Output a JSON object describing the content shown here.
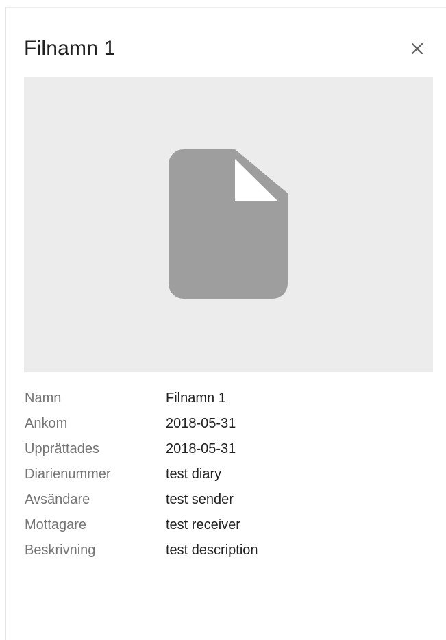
{
  "title": "Filnamn 1",
  "close_icon": "close-icon",
  "preview": {
    "icon": "file-icon",
    "background_color": "#ececec",
    "icon_color": "#9e9e9e"
  },
  "details": [
    {
      "label": "Namn",
      "value": "Filnamn 1"
    },
    {
      "label": "Ankom",
      "value": "2018-05-31"
    },
    {
      "label": "Upprättades",
      "value": "2018-05-31"
    },
    {
      "label": "Diarienummer",
      "value": "test diary"
    },
    {
      "label": "Avsändare",
      "value": "test sender"
    },
    {
      "label": "Mottagare",
      "value": "test receiver"
    },
    {
      "label": "Beskrivning",
      "value": "test description"
    }
  ]
}
